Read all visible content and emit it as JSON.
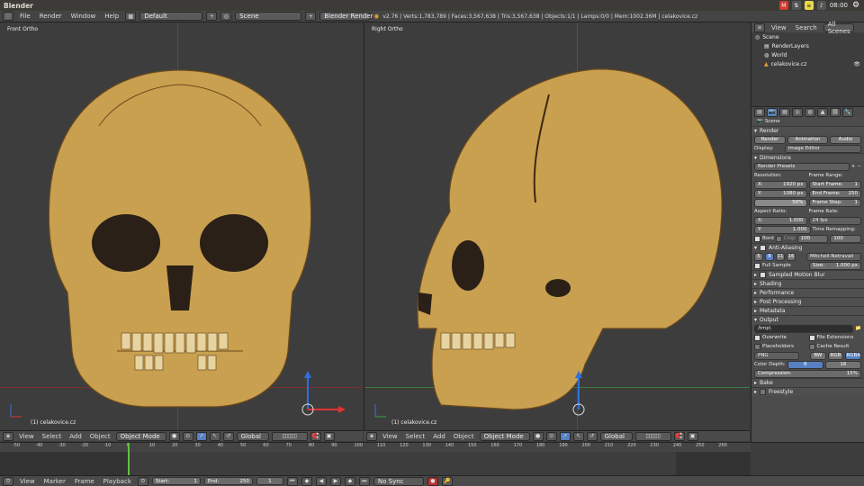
{
  "window": {
    "title": "Blender"
  },
  "tray": {
    "time": "08:00"
  },
  "infobar": {
    "menus": [
      "File",
      "Render",
      "Window",
      "Help"
    ],
    "layout": "Default",
    "scene": "Scene",
    "engine": "Blender Render",
    "stats": "v2.76 | Verts:1,783,789 | Faces:3,567,638 | Tris:3,567,638 | Objects:1/1 | Lamps:0/0 | Mem:1002.36M | celakovice.cz"
  },
  "viewport_left": {
    "label": "Front Ortho",
    "object": "(1) celakovice.cz"
  },
  "viewport_right": {
    "label": "Right Ortho",
    "object": "(1) celakovice.cz"
  },
  "header3d": {
    "menus": [
      "View",
      "Select",
      "Add",
      "Object"
    ],
    "mode": "Object Mode",
    "orientation": "Global"
  },
  "outliner": {
    "menus": [
      "View",
      "Search"
    ],
    "filter": "All Scenes",
    "items": [
      "Scene",
      "RenderLayers",
      "World",
      "celakovice.cz"
    ]
  },
  "props": {
    "context": "Scene",
    "render": {
      "title": "Render",
      "buttons": [
        "Render",
        "Animation",
        "Audio"
      ],
      "display_label": "Display:",
      "display_value": "Image Editor"
    },
    "dimensions": {
      "title": "Dimensions",
      "presets": "Render Presets",
      "resolution_label": "Resolution:",
      "res_x": "1920 px",
      "res_y": "1080 px",
      "res_pct": "50%",
      "frame_range_label": "Frame Range:",
      "start_label": "Start Frame:",
      "start": "1",
      "end_label": "End Frame:",
      "end": "250",
      "step_label": "Frame Step:",
      "step": "1",
      "aspect_label": "Aspect Ratio:",
      "asp_x": "1.000",
      "asp_y": "1.000",
      "frame_rate_label": "Frame Rate:",
      "fps": "24 fps",
      "remap_label": "Time Remapping:",
      "remap_old": "100",
      "remap_new": "100",
      "border": "Bord",
      "crop": "Crop"
    },
    "aa": {
      "title": "Anti-Aliasing",
      "samples": [
        "5",
        "8",
        "11",
        "16"
      ],
      "filter": "Mitchell-Netravali",
      "full_sample": "Full Sample",
      "size_label": "Size:",
      "size": "1.000 px"
    },
    "collapsed": [
      "Sampled Motion Blur",
      "Shading",
      "Performance",
      "Post Processing",
      "Metadata"
    ],
    "output": {
      "title": "Output",
      "path": "/tmp\\",
      "overwrite": "Overwrite",
      "file_ext": "File Extensions",
      "placeholders": "Placeholders",
      "cache": "Cache Result",
      "format": "PNG",
      "bw": "BW",
      "rgb": "RGB",
      "rgba": "RGBA",
      "depth_label": "Color Depth:",
      "depth_8": "8",
      "depth_16": "16",
      "compression_label": "Compression:",
      "compression": "15%"
    },
    "bake": "Bake",
    "freestyle": "Freestyle"
  },
  "timeline": {
    "ticks": [
      "-50",
      "-40",
      "-30",
      "-20",
      "-10",
      "0",
      "10",
      "20",
      "30",
      "40",
      "50",
      "60",
      "70",
      "80",
      "90",
      "100",
      "110",
      "120",
      "130",
      "140",
      "150",
      "160",
      "170",
      "180",
      "190",
      "200",
      "210",
      "220",
      "230",
      "240",
      "250",
      "260"
    ],
    "menus": [
      "View",
      "Marker",
      "Frame",
      "Playback"
    ],
    "start_label": "Start:",
    "start": "1",
    "end_label": "End:",
    "end": "250",
    "current": "1",
    "sync": "No Sync"
  },
  "colors": {
    "accent": "#5680c2",
    "bone": "#c9a04f",
    "viewport": "#3d3d3d"
  }
}
